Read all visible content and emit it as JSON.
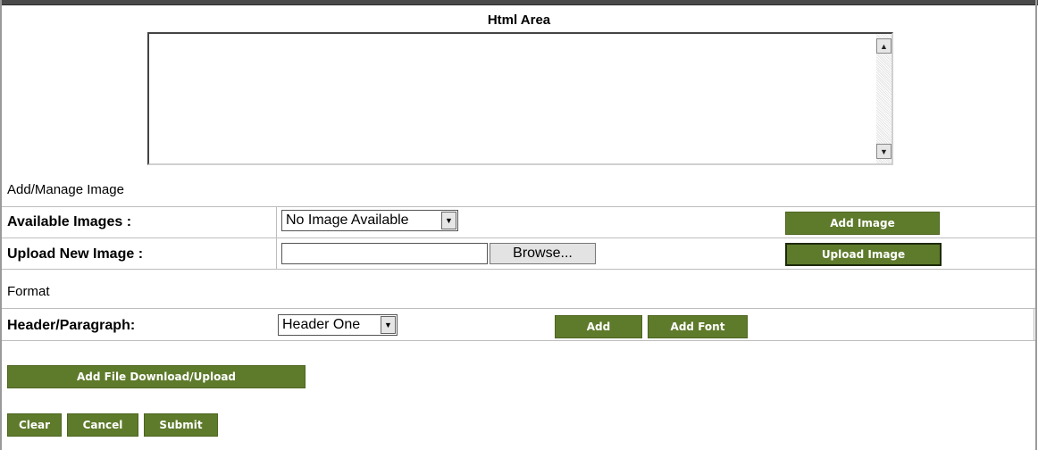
{
  "html_area": {
    "title": "Html Area",
    "value": ""
  },
  "image_section": {
    "heading": "Add/Manage Image",
    "available_images_label": "Available Images :",
    "available_images_selected": "No Image Available",
    "add_image_label": "Add Image",
    "upload_new_image_label": "Upload New Image :",
    "upload_value": "",
    "browse_label": "Browse...",
    "upload_image_label": "Upload Image"
  },
  "format_section": {
    "heading": "Format",
    "header_paragraph_label": "Header/Paragraph:",
    "header_paragraph_selected": "Header One",
    "add_label": "Add",
    "add_font_label": "Add Font"
  },
  "actions": {
    "add_file_label": "Add File Download/Upload",
    "clear_label": "Clear",
    "cancel_label": "Cancel",
    "submit_label": "Submit"
  },
  "colors": {
    "button_green": "#5e7a2b",
    "page_bg": "#ffffff"
  },
  "icons": [
    "scroll-up-arrow-icon",
    "scroll-down-arrow-icon",
    "dropdown-arrow-icon"
  ]
}
